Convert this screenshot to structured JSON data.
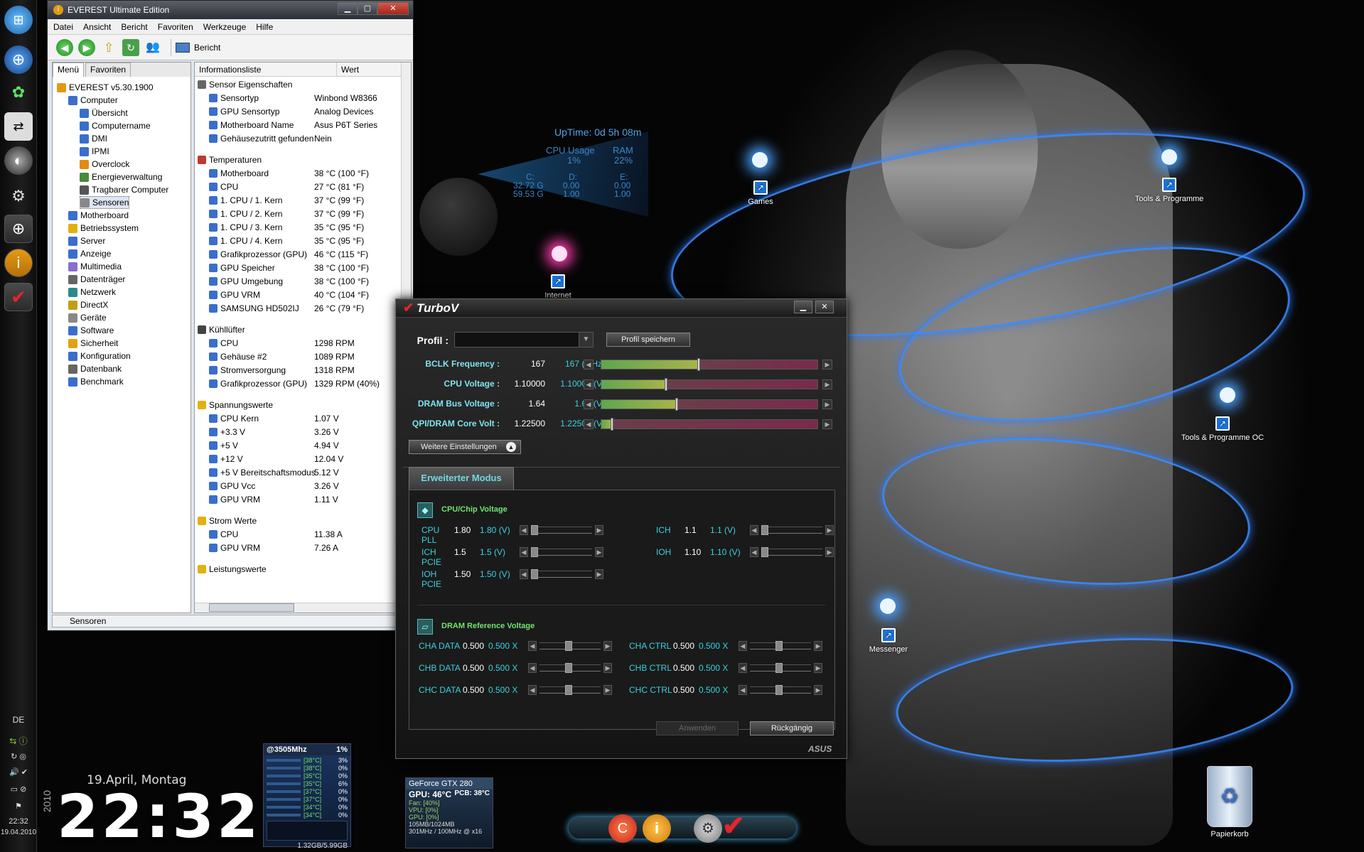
{
  "uptime": {
    "text": "UpTime: 0d 5h 08m",
    "cpu_label": "CPU Usage",
    "cpu_val": "1%",
    "ram_label": "RAM",
    "ram_val": "22%",
    "c_label": "C:",
    "c_val1": "32.72 G",
    "c_val2": "59.53 G",
    "d_label": "D:",
    "d_val1": "0.00",
    "d_val2": "1.00",
    "e_label": "E:",
    "e_val1": "0.00",
    "e_val2": "1.00"
  },
  "desktop_icons": [
    "Games",
    "Tools & Programme",
    "Internet",
    "Tools & Programme OC",
    "Messenger",
    "Papierkorb"
  ],
  "taskbar": {
    "lang": "DE",
    "time": "22:32",
    "date": "19.04.2010"
  },
  "clock": {
    "date": "19.April, Montag",
    "time": "22:32",
    "year": "2010"
  },
  "everest": {
    "title": "EVEREST Ultimate Edition",
    "menu": [
      "Datei",
      "Ansicht",
      "Bericht",
      "Favoriten",
      "Werkzeuge",
      "Hilfe"
    ],
    "toolbar_report": "Bericht",
    "tabs": [
      "Menü",
      "Favoriten"
    ],
    "tree": [
      "EVEREST v5.30.1900",
      "Computer",
      "Übersicht",
      "Computername",
      "DMI",
      "IPMI",
      "Overclock",
      "Energieverwaltung",
      "Tragbarer Computer",
      "Sensoren",
      "Motherboard",
      "Betriebssystem",
      "Server",
      "Anzeige",
      "Multimedia",
      "Datenträger",
      "Netzwerk",
      "DirectX",
      "Geräte",
      "Software",
      "Sicherheit",
      "Konfiguration",
      "Datenbank",
      "Benchmark"
    ],
    "col_info": "Informationsliste",
    "col_value": "Wert",
    "rows": [
      [
        "Sensor Eigenschaften",
        ""
      ],
      [
        "Sensortyp",
        "Winbond W8366"
      ],
      [
        "GPU Sensortyp",
        "Analog Devices"
      ],
      [
        "Motherboard Name",
        "Asus P6T Series"
      ],
      [
        "Gehäusezutritt gefunden",
        "Nein"
      ],
      [
        "Temperaturen",
        ""
      ],
      [
        "Motherboard",
        "38 °C  (100 °F)"
      ],
      [
        "CPU",
        "27 °C  (81 °F)"
      ],
      [
        "1. CPU / 1. Kern",
        "37 °C  (99 °F)"
      ],
      [
        "1. CPU / 2. Kern",
        "37 °C  (99 °F)"
      ],
      [
        "1. CPU / 3. Kern",
        "35 °C  (95 °F)"
      ],
      [
        "1. CPU / 4. Kern",
        "35 °C  (95 °F)"
      ],
      [
        "Grafikprozessor (GPU)",
        "46 °C  (115 °F)"
      ],
      [
        "GPU Speicher",
        "38 °C  (100 °F)"
      ],
      [
        "GPU Umgebung",
        "38 °C  (100 °F)"
      ],
      [
        "GPU VRM",
        "40 °C  (104 °F)"
      ],
      [
        "SAMSUNG HD502IJ",
        "26 °C  (79 °F)"
      ],
      [
        "Kühllüfter",
        ""
      ],
      [
        "CPU",
        "1298 RPM"
      ],
      [
        "Gehäuse #2",
        "1089 RPM"
      ],
      [
        "Stromversorgung",
        "1318 RPM"
      ],
      [
        "Grafikprozessor (GPU)",
        "1329 RPM  (40%)"
      ],
      [
        "Spannungswerte",
        ""
      ],
      [
        "CPU Kern",
        "1.07 V"
      ],
      [
        "+3.3 V",
        "3.26 V"
      ],
      [
        "+5 V",
        "4.94 V"
      ],
      [
        "+12 V",
        "12.04 V"
      ],
      [
        "+5 V Bereitschaftsmodus",
        "5.12 V"
      ],
      [
        "GPU Vcc",
        "3.26 V"
      ],
      [
        "GPU VRM",
        "1.11 V"
      ],
      [
        "Strom Werte",
        ""
      ],
      [
        "CPU",
        "11.38 A"
      ],
      [
        "GPU VRM",
        "7.26 A"
      ],
      [
        "Leistungswerte",
        ""
      ]
    ],
    "status": "Sensoren"
  },
  "turbov": {
    "title": "TurboV",
    "profil_label": "Profil :",
    "profil_save": "Profil speichern",
    "main": [
      {
        "label": "BCLK Frequency :",
        "cur": "167",
        "set": "167 (MHz)",
        "level": 0.45
      },
      {
        "label": "CPU Voltage :",
        "cur": "1.10000",
        "set": "1.10000 (V)",
        "level": 0.3
      },
      {
        "label": "DRAM Bus Voltage :",
        "cur": "1.64",
        "set": "1.64 (V)",
        "level": 0.35
      },
      {
        "label": "QPI/DRAM Core Volt :",
        "cur": "1.22500",
        "set": "1.22500 (V)",
        "level": 0.05
      }
    ],
    "more_settings": "Weitere Einstellungen",
    "advanced_tab": "Erweiterter Modus",
    "cpu_chip_title": "CPU/Chip Voltage",
    "chip": [
      {
        "label": "CPU PLL",
        "cur": "1.80",
        "set": "1.80 (V)"
      },
      {
        "label": "ICH PCIE",
        "cur": "1.5",
        "set": "1.5 (V)"
      },
      {
        "label": "IOH PCIE",
        "cur": "1.50",
        "set": "1.50 (V)"
      },
      {
        "label": "ICH",
        "cur": "1.1",
        "set": "1.1 (V)"
      },
      {
        "label": "IOH",
        "cur": "1.10",
        "set": "1.10 (V)"
      }
    ],
    "dram_title": "DRAM Reference Voltage",
    "dram": [
      {
        "label": "CHA DATA",
        "cur": "0.500",
        "set": "0.500 X"
      },
      {
        "label": "CHB DATA",
        "cur": "0.500",
        "set": "0.500 X"
      },
      {
        "label": "CHC DATA",
        "cur": "0.500",
        "set": "0.500 X"
      },
      {
        "label": "CHA CTRL",
        "cur": "0.500",
        "set": "0.500 X"
      },
      {
        "label": "CHB CTRL",
        "cur": "0.500",
        "set": "0.500 X"
      },
      {
        "label": "CHC CTRL",
        "cur": "0.500",
        "set": "0.500 X"
      }
    ],
    "apply": "Anwenden",
    "undo": "Rückgängig",
    "brand": "ASUS"
  },
  "cpu_gadget": {
    "title": "@3505Mhz",
    "usage": "1%",
    "temps": [
      "[38°C]",
      "[38°C]",
      "[35°C]",
      "[35°C]",
      "[37°C]",
      "[37°C]",
      "[34°C]",
      "[34°C]"
    ],
    "loads": [
      "3%",
      "0%",
      "0%",
      "6%",
      "0%",
      "0%",
      "0%",
      "0%"
    ],
    "mem": "1.32GB/5.99GB"
  },
  "gpu_gadget": {
    "name": "GeForce GTX 280",
    "gpu": "GPU: 46°C",
    "pcb": "PCB: 38°C",
    "fan": "Fan: [40%]",
    "vpu": "VPU: [0%]",
    "gpu_load": "GPU: [0%]",
    "mem": "105MB/1024MB",
    "clock": "301MHz / 100MHz @ x16"
  }
}
